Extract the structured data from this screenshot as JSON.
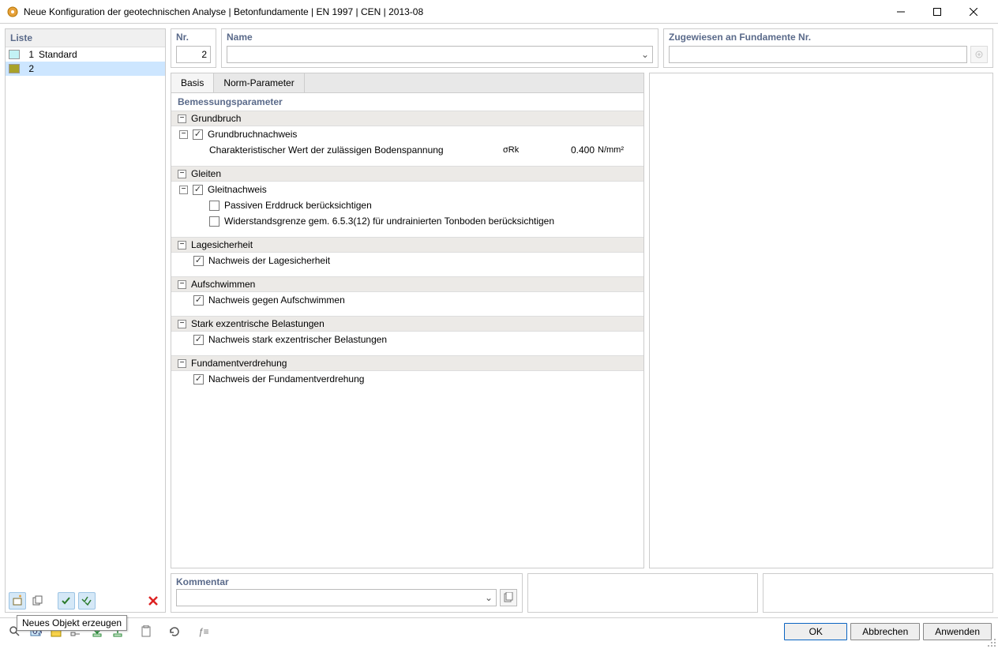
{
  "window": {
    "title": "Neue Konfiguration der geotechnischen Analyse | Betonfundamente | EN 1997 | CEN | 2013-08"
  },
  "sidebar": {
    "header": "Liste",
    "items": [
      {
        "num": "1",
        "label": "Standard",
        "swatch": "#c3f2f5"
      },
      {
        "num": "2",
        "label": "",
        "swatch": "#a8a22a"
      }
    ],
    "tooltip": "Neues Objekt erzeugen"
  },
  "top": {
    "nr": {
      "label": "Nr.",
      "value": "2"
    },
    "name": {
      "label": "Name",
      "value": ""
    },
    "assigned": {
      "label": "Zugewiesen an Fundamente Nr.",
      "value": ""
    }
  },
  "tabs": {
    "basis": "Basis",
    "norm": "Norm-Parameter"
  },
  "section": {
    "title": "Bemessungsparameter"
  },
  "groups": {
    "grundbruch": {
      "title": "Grundbruch",
      "nachweis": "Grundbruchnachweis",
      "char_label": "Charakteristischer Wert der zulässigen Bodenspannung",
      "char_sym": "σRk",
      "char_val": "0.400",
      "char_unit": "N/mm²"
    },
    "gleiten": {
      "title": "Gleiten",
      "nachweis": "Gleitnachweis",
      "passiv": "Passiven Erddruck berücksichtigen",
      "widerstand": "Widerstandsgrenze gem. 6.5.3(12) für undrainierten Tonboden berücksichtigen"
    },
    "lage": {
      "title": "Lagesicherheit",
      "nachweis": "Nachweis der Lagesicherheit"
    },
    "aufschwimmen": {
      "title": "Aufschwimmen",
      "nachweis": "Nachweis gegen Aufschwimmen"
    },
    "exzentrisch": {
      "title": "Stark exzentrische Belastungen",
      "nachweis": "Nachweis stark exzentrischer Belastungen"
    },
    "verdrehung": {
      "title": "Fundamentverdrehung",
      "nachweis": "Nachweis der Fundamentverdrehung"
    }
  },
  "comment": {
    "label": "Kommentar",
    "value": ""
  },
  "buttons": {
    "ok": "OK",
    "cancel": "Abbrechen",
    "apply": "Anwenden"
  }
}
